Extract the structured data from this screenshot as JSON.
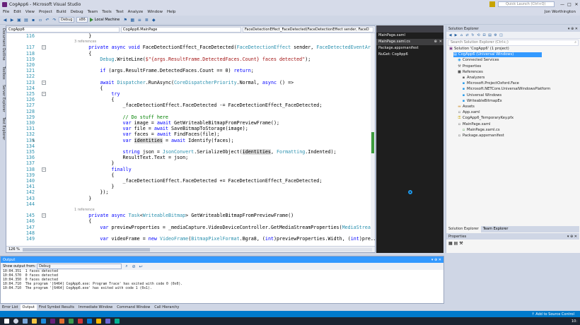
{
  "window": {
    "title": "CogApp6 - Microsoft Visual Studio",
    "quick_launch_placeholder": "Quick Launch (Ctrl+Q)",
    "user": "Jon Worthington",
    "minimize": "—",
    "maximize": "□",
    "close": "✕"
  },
  "menu": [
    "File",
    "Edit",
    "View",
    "Project",
    "Build",
    "Debug",
    "Team",
    "Tools",
    "Test",
    "Analyze",
    "Window",
    "Help"
  ],
  "toolbar": {
    "config": "Debug",
    "platform": "x86",
    "run_target": "Local Machine"
  },
  "left_tabs": [
    "Document Outline",
    "Toolbox",
    "Server Explorer",
    "Test Explorer"
  ],
  "editor": {
    "nav_project": "CogApp6",
    "nav_class": "CogApp6.MainPage",
    "nav_member": "FaceDetectionEffect_FaceDetected(FaceDetectionEffect sender, FaceD",
    "zoom": "126 %",
    "lines": [
      {
        "n": "116",
        "t": "        }"
      },
      {
        "n": "",
        "ref": "3 references"
      },
      {
        "n": "117",
        "t": "        private async void FaceDetectionEffect_FaceDetected(FaceDetectionEffect sender, FaceDetectedEventArgs args)"
      },
      {
        "n": "118",
        "t": "        {"
      },
      {
        "n": "119",
        "t": "            Debug.WriteLine($\"{args.ResultFrame.DetectedFaces.Count} faces detected\");"
      },
      {
        "n": "120",
        "t": ""
      },
      {
        "n": "121",
        "t": "            if (args.ResultFrame.DetectedFaces.Count == 0) return;"
      },
      {
        "n": "122",
        "t": ""
      },
      {
        "n": "123",
        "t": "            await Dispatcher.RunAsync(CoreDispatcherPriority.Normal, async () =>"
      },
      {
        "n": "124",
        "t": "            {"
      },
      {
        "n": "125",
        "t": "                try"
      },
      {
        "n": "126",
        "t": "                {"
      },
      {
        "n": "127",
        "t": "                    _faceDetectionEffect.FaceDetected -= FaceDetectionEffect_FaceDetected;"
      },
      {
        "n": "128",
        "t": ""
      },
      {
        "n": "129",
        "t": "                    // Do stuff here"
      },
      {
        "n": "130",
        "t": "                    var image = await GetWriteableBitmapFromPreviewFrame();"
      },
      {
        "n": "131",
        "t": "                    var file = await SaveBitmapToStorage(image);"
      },
      {
        "n": "132",
        "t": "                    var faces = await FindFaces(file);"
      },
      {
        "n": "133",
        "t": "                    var identities = await Identify(faces);"
      },
      {
        "n": "134",
        "t": ""
      },
      {
        "n": "135",
        "t": "                    string json = JsonConvert.SerializeObject(identities, Formatting.Indented);"
      },
      {
        "n": "136",
        "t": "                    ResultText.Text = json;"
      },
      {
        "n": "137",
        "t": "                }"
      },
      {
        "n": "138",
        "t": "                finally"
      },
      {
        "n": "139",
        "t": "                {"
      },
      {
        "n": "140",
        "t": "                    _faceDetectionEffect.FaceDetected += FaceDetectionEffect_FaceDetected;"
      },
      {
        "n": "141",
        "t": "                }"
      },
      {
        "n": "142",
        "t": "            });"
      },
      {
        "n": "143",
        "t": "        }"
      },
      {
        "n": "144",
        "t": ""
      },
      {
        "n": "",
        "ref": "1 reference"
      },
      {
        "n": "145",
        "t": "        private async Task<WriteableBitmap> GetWriteableBitmapFromPreviewFrame()"
      },
      {
        "n": "146",
        "t": "        {"
      },
      {
        "n": "147",
        "t": "            var previewProperties = _mediaCapture.VideoDeviceController.GetMediaStreamProperties(MediaStreamType.V"
      },
      {
        "n": "148",
        "t": ""
      },
      {
        "n": "149",
        "t": "            var videoFrame = new VideoFrame(BitmapPixelFormat.Bgra8, (int)previewProperties.Width, (int)previewPro"
      }
    ]
  },
  "doc_well": {
    "items": [
      {
        "label": "MainPage.xaml"
      },
      {
        "label": "MainPage.xaml.cs",
        "selected": true
      },
      {
        "label": "Package.appxmanifest"
      },
      {
        "label": "NuGet: CogApp6"
      }
    ]
  },
  "solution_explorer": {
    "title": "Solution Explorer",
    "search_placeholder": "Search Solution Explorer (Ctrl+;)",
    "tree": [
      {
        "label": "Solution 'CogApp6' (1 project)",
        "indent": 0,
        "icon": "solution-icon"
      },
      {
        "label": "CogApp6 (Universal Windows)",
        "indent": 1,
        "icon": "project-icon",
        "selected": true
      },
      {
        "label": "Connected Services",
        "indent": 2,
        "icon": "connected-services-icon"
      },
      {
        "label": "Properties",
        "indent": 2,
        "icon": "wrench-icon"
      },
      {
        "label": "References",
        "indent": 2,
        "icon": "references-icon"
      },
      {
        "label": "Analyzers",
        "indent": 3,
        "icon": "analyzer-icon"
      },
      {
        "label": "Microsoft.ProjectOxford.Face",
        "indent": 3,
        "icon": "reference-icon"
      },
      {
        "label": "Microsoft.NETCore.UniversalWindowsPlatform",
        "indent": 3,
        "icon": "reference-icon"
      },
      {
        "label": "Universal Windows",
        "indent": 3,
        "icon": "reference-icon"
      },
      {
        "label": "WriteableBitmapEx",
        "indent": 3,
        "icon": "reference-icon"
      },
      {
        "label": "Assets",
        "indent": 2,
        "icon": "folder-icon"
      },
      {
        "label": "App.xaml",
        "indent": 2,
        "icon": "xaml-icon"
      },
      {
        "label": "CogApp6_TemporaryKey.pfx",
        "indent": 2,
        "icon": "key-icon"
      },
      {
        "label": "MainPage.xaml",
        "indent": 2,
        "icon": "xaml-icon"
      },
      {
        "label": "MainPage.xaml.cs",
        "indent": 3,
        "icon": "cs-icon"
      },
      {
        "label": "Package.appxmanifest",
        "indent": 2,
        "icon": "manifest-icon"
      }
    ],
    "tabs": [
      "Solution Explorer",
      "Team Explorer"
    ],
    "properties_title": "Properties"
  },
  "output": {
    "title": "Output",
    "show_from_label": "Show output from:",
    "source": "Debug",
    "lines": [
      "10:04.351  1 faces detected",
      "10:04.570  0 faces detected",
      "10:04.350  0 faces detected",
      "10:04.710  The program '[6464] CogApp6.exe: Program Trace' has exited with code 0 (0x0).",
      "10:04.710  The program '[6464] CogApp6.exe' has exited with code 1 (0x1)."
    ]
  },
  "bottom_tabs": [
    "Error List",
    "Output",
    "Find Symbol Results",
    "Immediate Window",
    "Command Window",
    "Call Hierarchy"
  ],
  "status": {
    "right": "↑ Add to Source Control"
  },
  "taskbar": {
    "clock": "10:"
  },
  "colors": {
    "accent": "#007acc",
    "keyword": "#0000ff",
    "type": "#2b91af",
    "string": "#a31515",
    "comment": "#008000"
  }
}
